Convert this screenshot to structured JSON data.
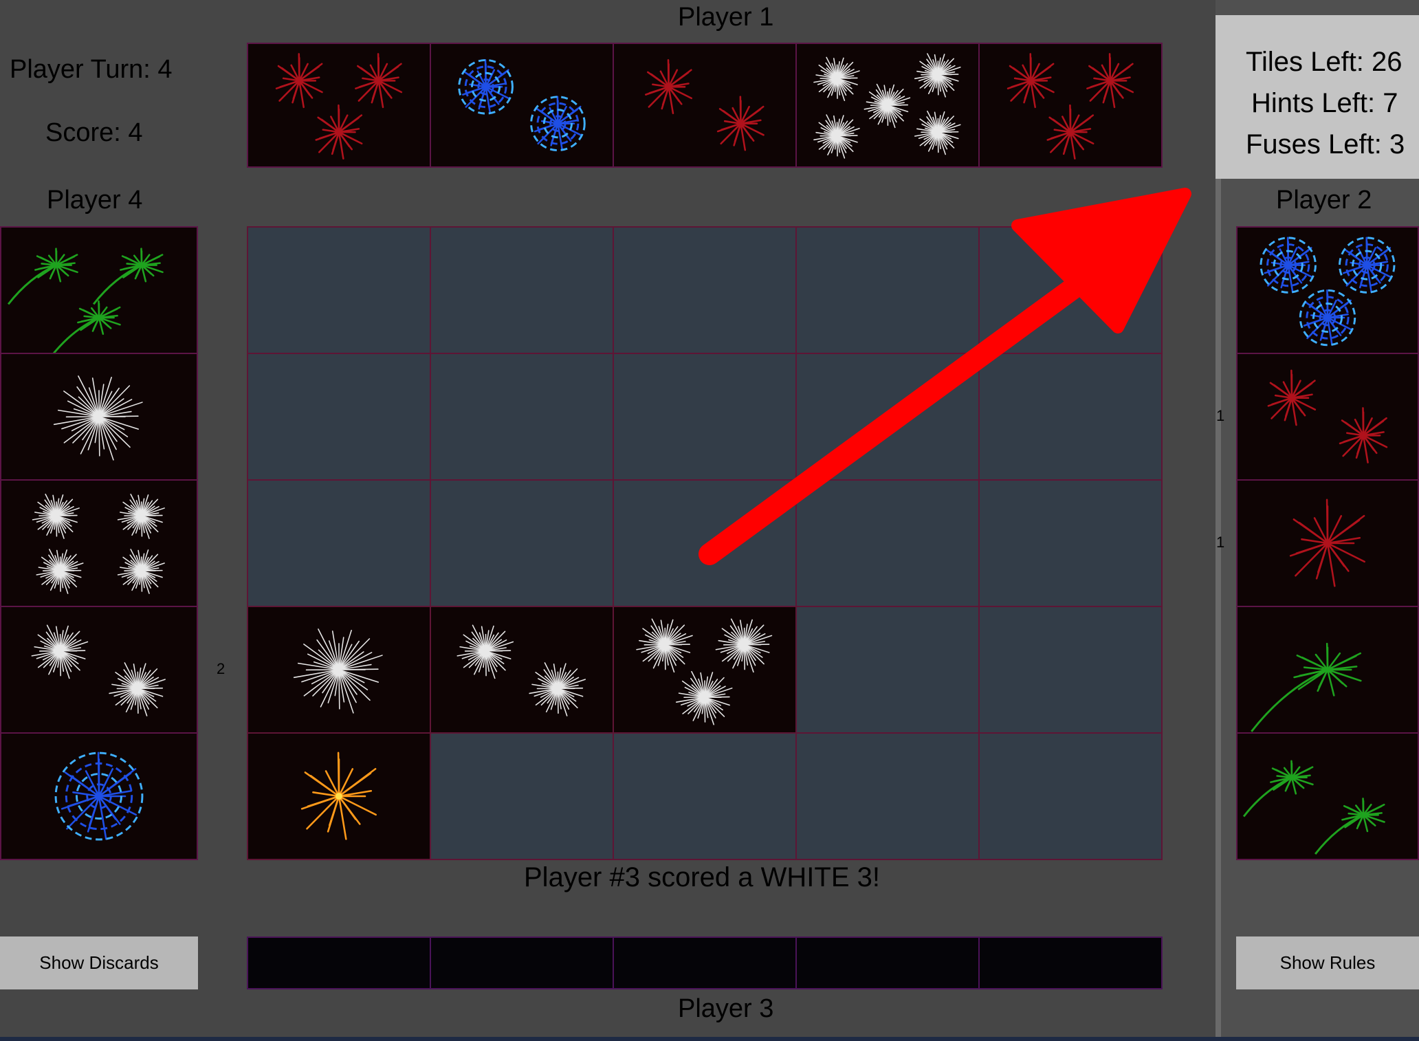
{
  "header": {
    "player1_label": "Player 1",
    "player3_label": "Player 3"
  },
  "status": {
    "player_turn": "Player Turn: 4",
    "score": "Score: 4",
    "tiles_left": "Tiles Left: 26",
    "hints_left": "Hints Left: 7",
    "fuses_left": "Fuses Left: 3"
  },
  "player4": {
    "label": "Player 4"
  },
  "player2": {
    "label": "Player 2"
  },
  "message": "Player #3 scored a WHITE 3!",
  "buttons": {
    "show_discards": "Show Discards",
    "show_rules": "Show Rules"
  },
  "markers": {
    "row4_marker": "2",
    "p2_row2_marker": "1",
    "p2_row3_marker": "1"
  },
  "colors": {
    "red": "#b0121c",
    "blue": "#1f4fe6",
    "white": "#e8e8e8",
    "green": "#1fa31f",
    "yellow": "#ff9a1a",
    "arrow": "#ff0000"
  },
  "player1_hand": [
    {
      "color": "red",
      "count": 3
    },
    {
      "color": "blue",
      "count": 2
    },
    {
      "color": "red",
      "count": 2
    },
    {
      "color": "white",
      "count": 5
    },
    {
      "color": "red",
      "count": 3
    }
  ],
  "player4_hand": [
    {
      "color": "green",
      "count": 3
    },
    {
      "color": "white",
      "count": 1
    },
    {
      "color": "white",
      "count": 4
    },
    {
      "color": "white",
      "count": 2
    },
    {
      "color": "blue",
      "count": 1
    }
  ],
  "player2_hand": [
    {
      "color": "blue",
      "count": 3
    },
    {
      "color": "red",
      "count": 2
    },
    {
      "color": "red",
      "count": 1
    },
    {
      "color": "green",
      "count": 1
    },
    {
      "color": "green",
      "count": 2
    }
  ],
  "board_rows": [
    [
      null,
      null,
      null,
      null,
      null
    ],
    [
      null,
      null,
      null,
      null,
      null
    ],
    [
      null,
      null,
      null,
      null,
      null
    ],
    [
      {
        "color": "white",
        "count": 1
      },
      {
        "color": "white",
        "count": 2
      },
      {
        "color": "white",
        "count": 3
      },
      null,
      null
    ],
    [
      {
        "color": "yellow",
        "count": 1
      },
      null,
      null,
      null,
      null
    ]
  ],
  "player3_hand_hidden": 5
}
